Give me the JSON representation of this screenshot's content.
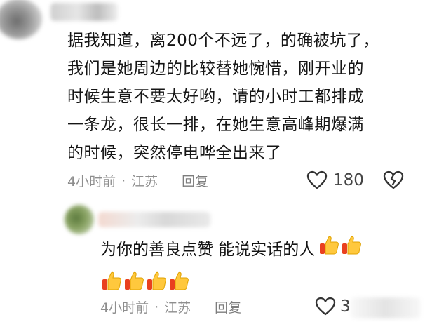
{
  "comment": {
    "lines": [
      "据我知道，离200个不远了，的确被坑了，",
      "我们是她周边的比较替她惋惜，刚开业的",
      "时候生意不要太好哟，请的小时工都排成",
      "一条龙，很长一排，在她生意高峰期爆满",
      "的时候，突然停电哗全出来了"
    ],
    "time": "4小时前",
    "location": "江苏",
    "reply_label": "回复",
    "like_count": "180"
  },
  "reply": {
    "text": "为你的善良点赞 能说实话的人",
    "time": "4小时前",
    "location": "江苏",
    "reply_label": "回复",
    "like_count": "3"
  },
  "icons": {
    "like": "heart-outline-icon",
    "dislike": "broken-heart-outline-icon",
    "emoji": "thumbs-up-emoji"
  }
}
